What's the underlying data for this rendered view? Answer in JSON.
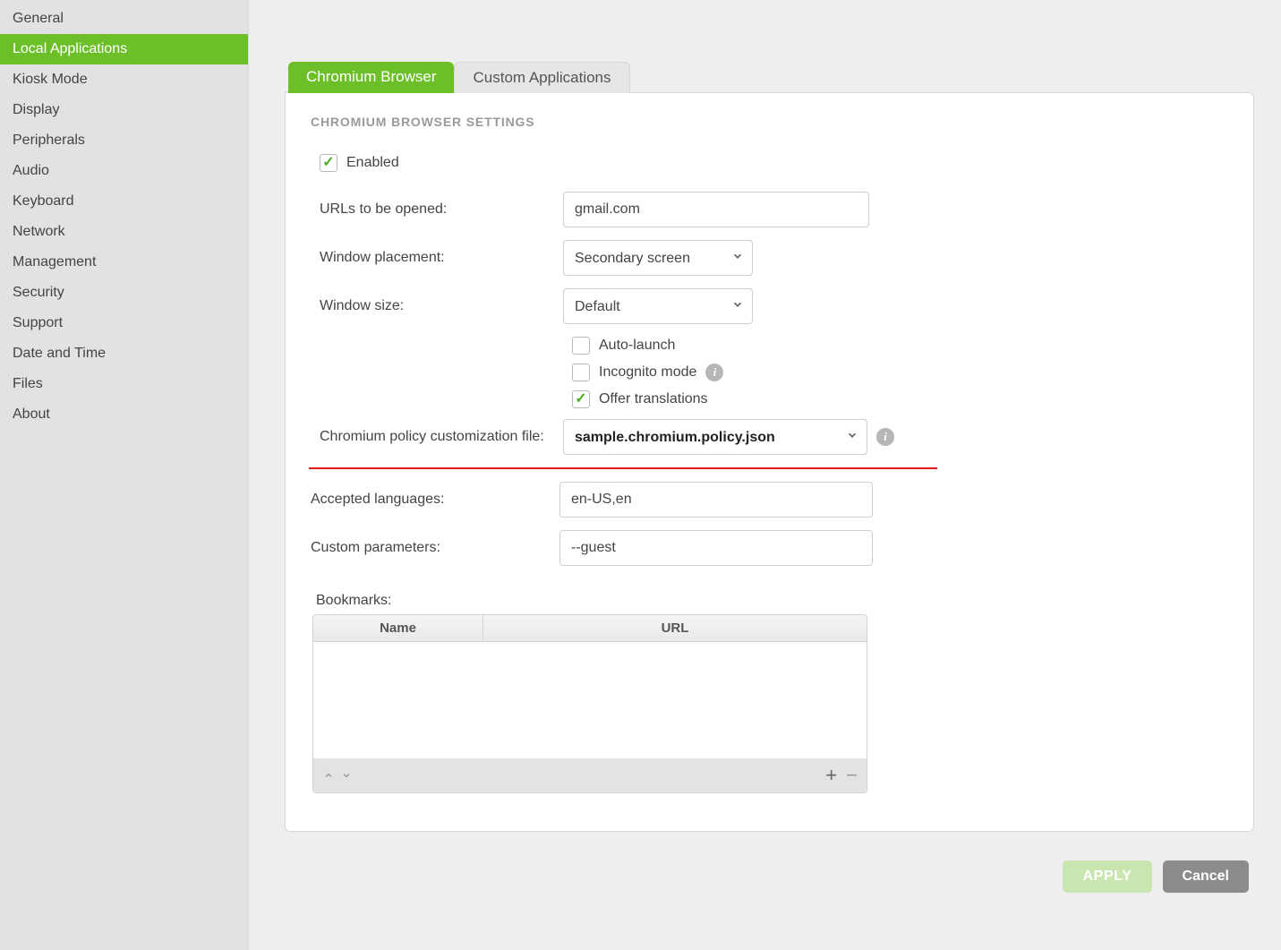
{
  "sidebar": {
    "items": [
      {
        "label": "General"
      },
      {
        "label": "Local Applications"
      },
      {
        "label": "Kiosk Mode"
      },
      {
        "label": "Display"
      },
      {
        "label": "Peripherals"
      },
      {
        "label": "Audio"
      },
      {
        "label": "Keyboard"
      },
      {
        "label": "Network"
      },
      {
        "label": "Management"
      },
      {
        "label": "Security"
      },
      {
        "label": "Support"
      },
      {
        "label": "Date and Time"
      },
      {
        "label": "Files"
      },
      {
        "label": "About"
      }
    ],
    "active_index": 1
  },
  "tabs": {
    "items": [
      {
        "label": "Chromium Browser"
      },
      {
        "label": "Custom Applications"
      }
    ],
    "active_index": 0
  },
  "panel": {
    "section_title": "Chromium Browser Settings",
    "enabled_label": "Enabled",
    "enabled_checked": true,
    "urls_label": "URLs to be opened:",
    "urls_value": "gmail.com",
    "placement_label": "Window placement:",
    "placement_value": "Secondary screen",
    "size_label": "Window size:",
    "size_value": "Default",
    "autolaunch_label": "Auto-launch",
    "autolaunch_checked": false,
    "incognito_label": "Incognito mode",
    "incognito_checked": false,
    "translations_label": "Offer translations",
    "translations_checked": true,
    "policy_label": "Chromium policy customization file:",
    "policy_value": "sample.chromium.policy.json",
    "languages_label": "Accepted languages:",
    "languages_value": "en-US,en",
    "params_label": "Custom parameters:",
    "params_value": "--guest",
    "bookmarks_label": "Bookmarks:",
    "bookmarks_header_name": "Name",
    "bookmarks_header_url": "URL"
  },
  "buttons": {
    "apply": "APPLY",
    "cancel": "Cancel"
  }
}
